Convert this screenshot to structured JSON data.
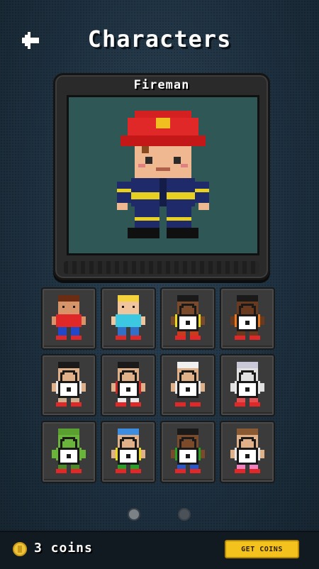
{
  "header": {
    "title": "Characters",
    "back_icon": "arrow-left-icon"
  },
  "preview": {
    "name": "Fireman"
  },
  "characters": [
    {
      "name": "kid-red-shirt",
      "locked": false,
      "skin": "#d79468",
      "hair": "#6a2c12",
      "shirt": "#e02828",
      "pants": "#2248c8"
    },
    {
      "name": "girl-blonde",
      "locked": false,
      "skin": "#f0c49c",
      "hair": "#f4d23c",
      "shirt": "#3cc8e0",
      "pants": "#3270c8"
    },
    {
      "name": "locked-dreadlocks",
      "locked": true,
      "skin": "#7a4a2a",
      "hair": "#1a1a1a",
      "shirt": "#e8d820",
      "pants": "#c83c1c"
    },
    {
      "name": "locked-afro",
      "locked": true,
      "skin": "#6a3a1e",
      "hair": "#1a1a1a",
      "shirt": "#e87820",
      "pants": "#6a3a1e"
    },
    {
      "name": "locked-karate",
      "locked": true,
      "skin": "#e0b088",
      "hair": "#1a1a1a",
      "shirt": "#e8e8e8",
      "pants": "#c8b090"
    },
    {
      "name": "locked-buns",
      "locked": true,
      "skin": "#e0b088",
      "hair": "#1a1a1a",
      "shirt": "#c82828",
      "pants": "#e8e8e8"
    },
    {
      "name": "locked-chef",
      "locked": true,
      "skin": "#e0b088",
      "hair": "#f0f0f0",
      "shirt": "#e8e8e8",
      "pants": "#3a3a3a"
    },
    {
      "name": "locked-astronaut",
      "locked": true,
      "skin": "#e0e0e0",
      "hair": "#c8c8d8",
      "shirt": "#e8e8e8",
      "pants": "#e05050"
    },
    {
      "name": "locked-dino",
      "locked": true,
      "skin": "#6ab43c",
      "hair": "#5aa030",
      "shirt": "#6ab43c",
      "pants": "#4a8a28"
    },
    {
      "name": "locked-blue-hat",
      "locked": true,
      "skin": "#e0b088",
      "hair": "#3c8ce0",
      "shirt": "#e8d820",
      "pants": "#28a028"
    },
    {
      "name": "locked-rasta",
      "locked": true,
      "skin": "#7a4a2a",
      "hair": "#1a1a1a",
      "shirt": "#28a028",
      "pants": "#2858c8"
    },
    {
      "name": "locked-girl-pink",
      "locked": true,
      "skin": "#e0b088",
      "hair": "#8a5a32",
      "shirt": "#e8e8e8",
      "pants": "#f080c0"
    }
  ],
  "pager": {
    "pages": 2,
    "current": 1
  },
  "footer": {
    "coin_icon": "coin-icon",
    "coins_text": "3 coins",
    "get_coins_label": "GET COINS"
  }
}
